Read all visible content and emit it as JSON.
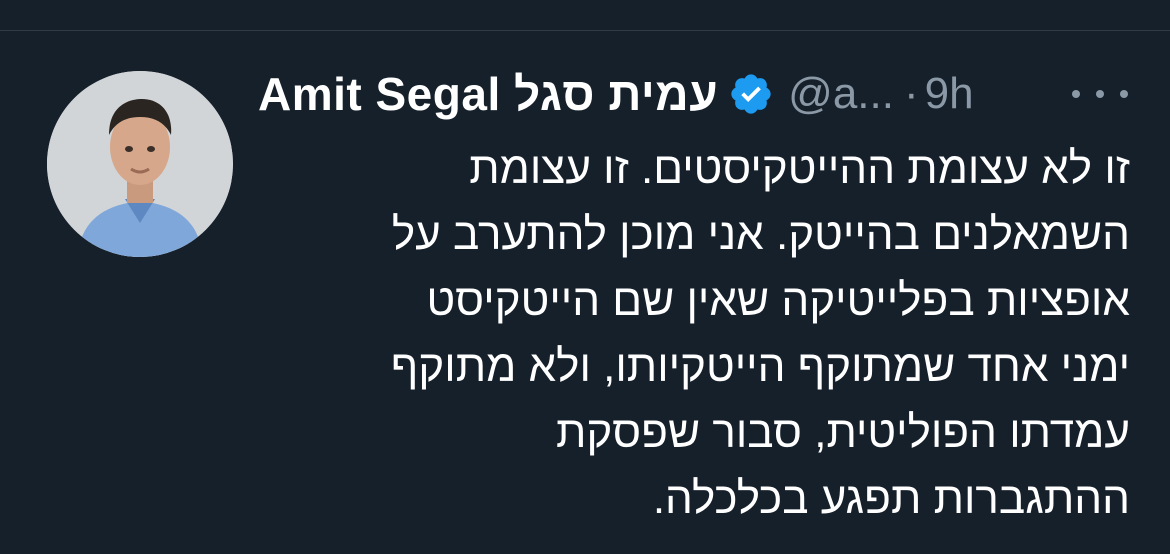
{
  "tweet": {
    "display_name": "Amit Segal עמית סגל",
    "handle": "@a...",
    "separator": "·",
    "time": "9h",
    "lines": [
      "זו לא עצומת ההייטקיסטים. זו עצומת",
      "השמאלנים בהייטק. אני מוכן להתערב על",
      "אופציות בפלייטיקה שאין שם הייטקיסט",
      "ימני אחד שמתוקף הייטקיותו, ולא מתוקף",
      "עמדתו הפוליטית, סבור שפסקת",
      "ההתגברות תפגע בכלכלה."
    ]
  },
  "icons": {
    "verified": "verified-badge-icon",
    "more": "more-dots-icon",
    "avatar": "profile-photo"
  },
  "colors": {
    "background": "#15202b",
    "primary_text": "#ffffff",
    "secondary_text": "#8b98a5",
    "verified_blue": "#1d9bf0"
  }
}
